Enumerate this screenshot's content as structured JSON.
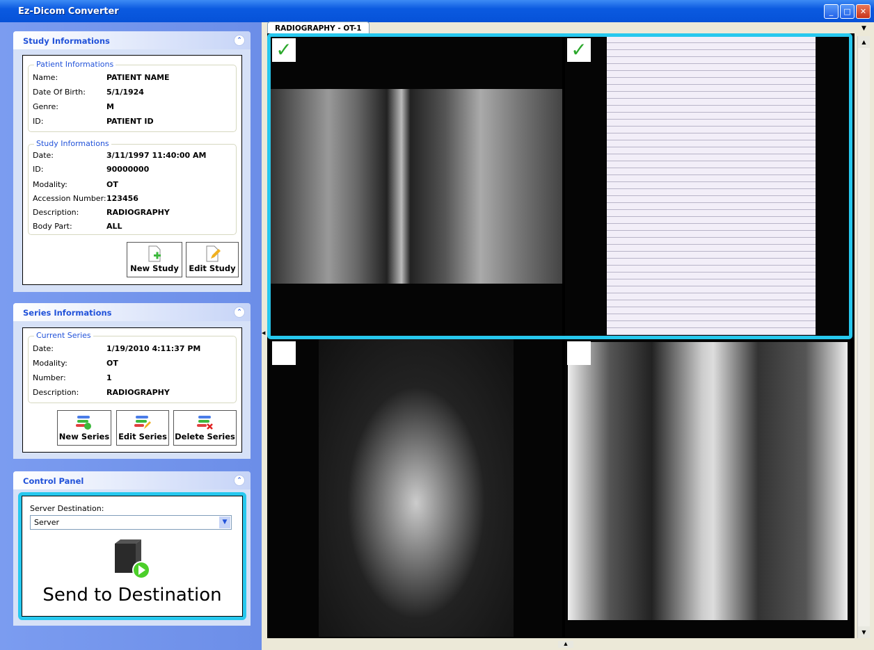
{
  "window": {
    "title": "Ez-Dicom Converter"
  },
  "study_panel": {
    "title": "Study Informations",
    "patient_group": {
      "title": "Patient Informations",
      "rows": [
        [
          "Name:",
          "PATIENT NAME"
        ],
        [
          "Date Of Birth:",
          "5/1/1924"
        ],
        [
          "Genre:",
          "M"
        ],
        [
          "ID:",
          "PATIENT ID"
        ]
      ]
    },
    "study_group": {
      "title": "Study Informations",
      "rows": [
        [
          "Date:",
          "3/11/1997 11:40:00 AM"
        ],
        [
          "ID:",
          "90000000"
        ],
        [
          "Modality:",
          "OT"
        ],
        [
          "Accession Number:",
          "123456"
        ],
        [
          "Description:",
          "RADIOGRAPHY"
        ],
        [
          "Body Part:",
          "ALL"
        ]
      ]
    },
    "new_study": "New Study",
    "edit_study": "Edit Study"
  },
  "series_panel": {
    "title": "Series Informations",
    "current_group": {
      "title": "Current Series",
      "rows": [
        [
          "Date:",
          "1/19/2010 4:11:37 PM"
        ],
        [
          "Modality:",
          "OT"
        ],
        [
          "Number:",
          "1"
        ],
        [
          "Description:",
          "RADIOGRAPHY"
        ]
      ]
    },
    "new_series": "New Series",
    "edit_series": "Edit Series",
    "delete_series": "Delete Series"
  },
  "control_panel": {
    "title": "Control Panel",
    "server_label": "Server Destination:",
    "server_value": "Server",
    "send_label": "Send to Destination"
  },
  "viewer": {
    "tab": "RADIOGRAPHY - OT-1",
    "accent": "#27c8ee",
    "images": [
      {
        "name": "knee x-ray",
        "checked": true
      },
      {
        "name": "operative report document",
        "checked": true
      },
      {
        "name": "hand x-ray",
        "checked": false
      },
      {
        "name": "chest x-ray",
        "checked": false
      }
    ]
  }
}
